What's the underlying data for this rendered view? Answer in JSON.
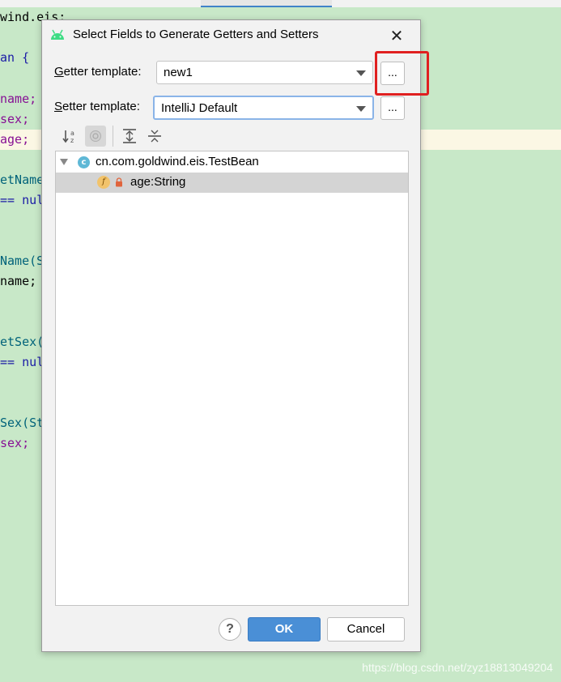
{
  "editor": {
    "lines": [
      "wind.eis;",
      "an {",
      "name;",
      "sex;",
      "age;",
      "etName(",
      "== nul",
      "Name(St",
      "name;",
      "etSex()",
      "== null",
      "Sex(Str",
      "sex;"
    ]
  },
  "dialog": {
    "title": "Select Fields to Generate Getters and Setters",
    "getter": {
      "label_accel": "G",
      "label_rest": "etter template:",
      "value": "new1",
      "more_label": "..."
    },
    "setter": {
      "label_accel": "S",
      "label_rest": "etter template:",
      "value": "IntelliJ Default",
      "more_label": "..."
    },
    "toolbar": {
      "sort_icon_text": "↓a z"
    },
    "tree": {
      "class_icon_letter": "c",
      "class_name": "cn.com.goldwind.eis.TestBean",
      "field_icon_letter": "f",
      "field_name": "age:String"
    },
    "help_label": "?",
    "ok_label": "OK",
    "cancel_label": "Cancel"
  },
  "watermark": "https://blog.csdn.net/zyz18813049204",
  "colors": {
    "editor_bg": "#c8e8c8",
    "ok_blue": "#4a8fd6",
    "highlight_red": "#e02020",
    "android_green": "#3ddc84"
  }
}
